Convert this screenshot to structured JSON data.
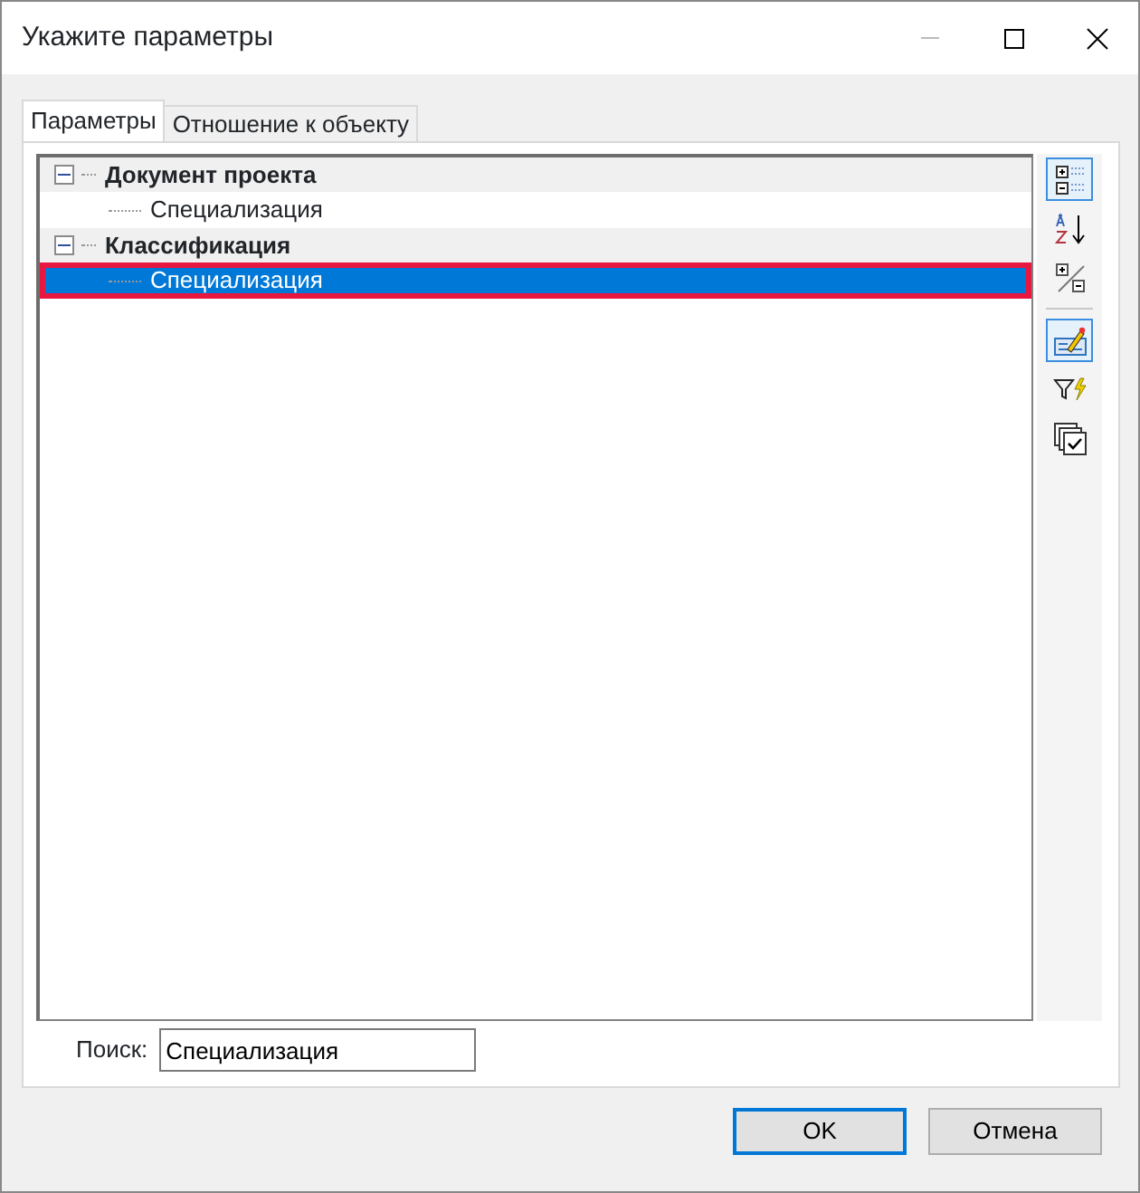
{
  "window": {
    "title": "Укажите параметры"
  },
  "tabs": [
    {
      "label": "Параметры",
      "selected": true
    },
    {
      "label": "Отношение к объекту",
      "selected": false
    }
  ],
  "tree": [
    {
      "label": "Документ проекта",
      "expanded": true,
      "children": [
        {
          "label": "Специализация",
          "selected": false,
          "highlighted": false
        }
      ]
    },
    {
      "label": "Классификация",
      "expanded": true,
      "children": [
        {
          "label": "Специализация",
          "selected": true,
          "highlighted": true
        }
      ]
    }
  ],
  "toolbar": [
    {
      "kind": "categorized",
      "pressed": true
    },
    {
      "kind": "sort",
      "pressed": false
    },
    {
      "kind": "expand",
      "pressed": false
    },
    {
      "kind": "separator"
    },
    {
      "kind": "edit",
      "pressed": true
    },
    {
      "kind": "filter",
      "pressed": false
    },
    {
      "kind": "check",
      "pressed": false
    }
  ],
  "search": {
    "label": "Поиск:",
    "value": "Специализация"
  },
  "buttons": [
    {
      "label": "OK",
      "default": true
    },
    {
      "label": "Отмена",
      "default": false
    }
  ]
}
